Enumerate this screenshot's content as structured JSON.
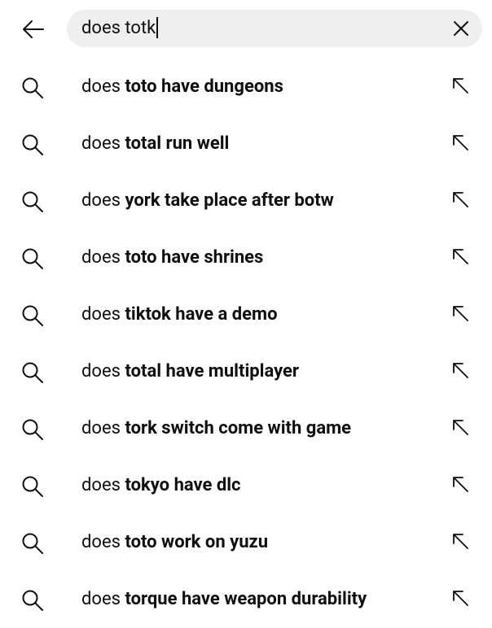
{
  "header": {
    "back_icon": "arrow-left-icon",
    "search_value": "does totk",
    "clear_icon": "close-icon"
  },
  "suggestions": [
    {
      "prefix": "does ",
      "suffix": "toto have dungeons"
    },
    {
      "prefix": "does ",
      "suffix": "total run well"
    },
    {
      "prefix": "does ",
      "suffix": "york take place after botw"
    },
    {
      "prefix": "does ",
      "suffix": "toto have shrines"
    },
    {
      "prefix": "does ",
      "suffix": "tiktok have a demo"
    },
    {
      "prefix": "does ",
      "suffix": "total have multiplayer"
    },
    {
      "prefix": "does ",
      "suffix": "tork switch come with game"
    },
    {
      "prefix": "does ",
      "suffix": "tokyo have dlc"
    },
    {
      "prefix": "does ",
      "suffix": "toto work on yuzu"
    },
    {
      "prefix": "does ",
      "suffix": "torque have weapon durability"
    }
  ],
  "icons": {
    "row_left": "search-icon",
    "row_right": "arrow-up-left-icon"
  }
}
